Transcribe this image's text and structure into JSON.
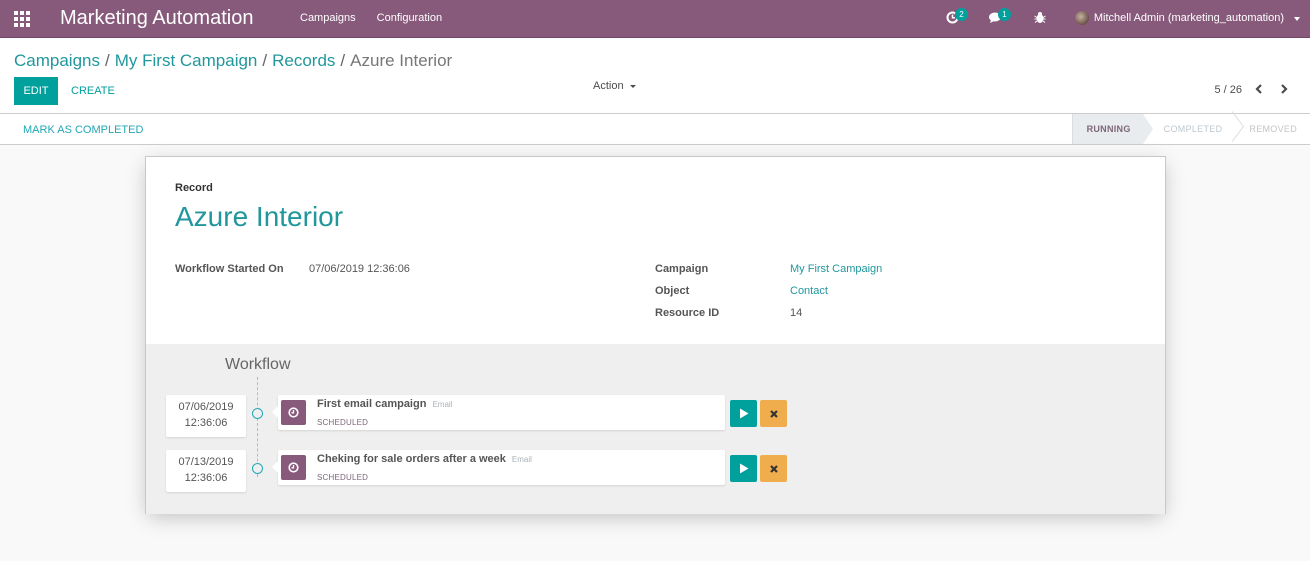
{
  "navbar": {
    "app_title": "Marketing Automation",
    "menu": [
      "Campaigns",
      "Configuration"
    ],
    "activity_count": "2",
    "message_count": "1",
    "user_name": "Mitchell Admin (marketing_automation)",
    "brand_color": "#875a7b"
  },
  "breadcrumb": {
    "items": [
      "Campaigns",
      "My First Campaign",
      "Records"
    ],
    "current": "Azure Interior",
    "separator": "/"
  },
  "toolbar": {
    "edit_label": "EDIT",
    "create_label": "CREATE",
    "action_label": "Action",
    "pager": "5 / 26"
  },
  "statusbar": {
    "mark_completed_label": "MARK AS COMPLETED",
    "stages": [
      "RUNNING",
      "COMPLETED",
      "REMOVED"
    ],
    "current_stage": "RUNNING"
  },
  "record": {
    "label": "Record",
    "title": "Azure Interior",
    "fields_left": [
      {
        "label": "Workflow Started On",
        "value": "07/06/2019 12:36:06"
      }
    ],
    "fields_right": [
      {
        "label": "Campaign",
        "value": "My First Campaign"
      },
      {
        "label": "Object",
        "value": "Contact"
      },
      {
        "label": "Resource ID",
        "value": "14"
      }
    ]
  },
  "workflow": {
    "title": "Workflow",
    "activities": [
      {
        "date": "07/06/2019",
        "time": "12:36:06",
        "name": "First email campaign",
        "type": "Email",
        "state": "SCHEDULED"
      },
      {
        "date": "07/13/2019",
        "time": "12:36:06",
        "name": "Cheking for sale orders after a week",
        "type": "Email",
        "state": "SCHEDULED"
      }
    ]
  },
  "colors": {
    "accent": "#00a09d",
    "link": "#21979d",
    "warning": "#f0ad4e"
  }
}
